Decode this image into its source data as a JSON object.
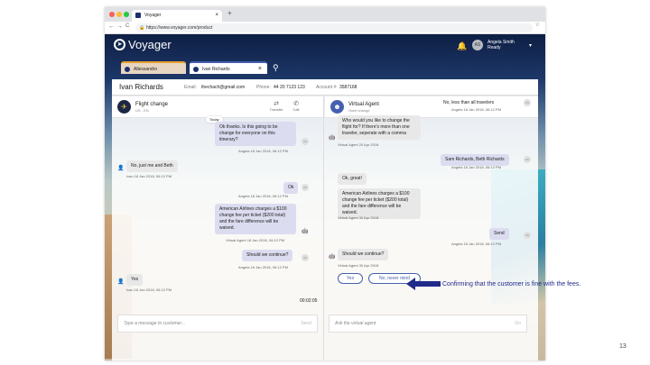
{
  "browser": {
    "tab_title": "Voyager",
    "tab_close": "×",
    "new_tab": "+",
    "url": "https://www.voyager.com/product",
    "nav_back": "←",
    "nav_forward": "→",
    "nav_reload": "C",
    "lock": "🔒",
    "star": "☆"
  },
  "app": {
    "logo": "Voyager",
    "bell": "🔔",
    "user": {
      "initials": "AS",
      "name": "Angela Smith",
      "status": "Ready"
    },
    "chevron": "⌄"
  },
  "conv_tabs": [
    {
      "label": "Allessandro",
      "badge_color": "#1a2f6e"
    },
    {
      "label": "Ivan Richards",
      "badge_color": "#1a2f6e",
      "close": "×"
    }
  ],
  "customer": {
    "name": "Ivan Richards",
    "email_label": "Email:",
    "email": "thechach@gmail.com",
    "phone_label": "Phone:",
    "phone": "44 20 7123 123",
    "account_label": "Account #:",
    "account": "3587168"
  },
  "left_panel": {
    "title": "Flight change",
    "subtitle": "US - EN",
    "transfer": "Transfer",
    "call": "Call",
    "today": "Today",
    "timer": "00:02:05",
    "input_placeholder": "Type a message to customer...",
    "send": "Send",
    "messages": [
      {
        "text": "Ok thanks. Is this going to be change for everyone on this itinerary?",
        "meta": "Angela 18 Jan 2018, 06:12 PM",
        "avatar": "AS"
      },
      {
        "text": "No, just me and Beth",
        "meta": "Ivan 18 Jan 2018, 06:12 PM"
      },
      {
        "text": "Ok",
        "meta": "Angela 18 Jan 2018, 06:12 PM",
        "avatar": "AS"
      },
      {
        "text": "American Airlines charges a $100 change fee per ticket ($200 total) and the fare difference will be waived.",
        "meta": "Virtual Agent 18 Jan 2018, 06:12 PM"
      },
      {
        "text": "Should we continue?",
        "meta": "Angela 18 Jan 2018, 06:12 PM",
        "avatar": "AS"
      },
      {
        "text": "Yes",
        "meta": "Ivan 18 Jan 2018, 06:12 PM"
      }
    ]
  },
  "right_panel": {
    "title": "Virtual Agent",
    "subtitle": "Hotel change",
    "input_placeholder": "Ask the virtual agent",
    "go": "Go",
    "messages": [
      {
        "text": "No, less than all travelers",
        "meta": "Angela 18 Jan 2018, 06:12 PM",
        "avatar": "AS"
      },
      {
        "text": "Who would you like to change the flight for? If there's more than one traveler, seperate with a comma",
        "meta": "Virtual Agent 20 Apr 2018"
      },
      {
        "text": "Sam Richards, Beth Richards",
        "meta": "Angela 18 Jan 2018, 06:12 PM",
        "avatar": "AS"
      },
      {
        "text": "Ok, great!",
        "meta": ""
      },
      {
        "text": "American Airlines charges a $100 change fee per ticket ($200 total) and the fare difference will be waived.",
        "meta": "Virtual Agent 30 Apr 2018"
      },
      {
        "text": "Send",
        "meta": "Angela 18 Jan 2018, 06:12 PM",
        "avatar": "AS"
      },
      {
        "text": "Should we continue?",
        "meta": "Virtual Agent 30 Apr 2018"
      }
    ],
    "quick_replies": [
      "Yes",
      "No, never mind"
    ]
  },
  "annotation": "Confirming that the customer is fine with the fees.",
  "page_number": "13",
  "colors": {
    "accent": "#4660b0",
    "arrow": "#1f2a8a",
    "header": "#0e1f44"
  }
}
